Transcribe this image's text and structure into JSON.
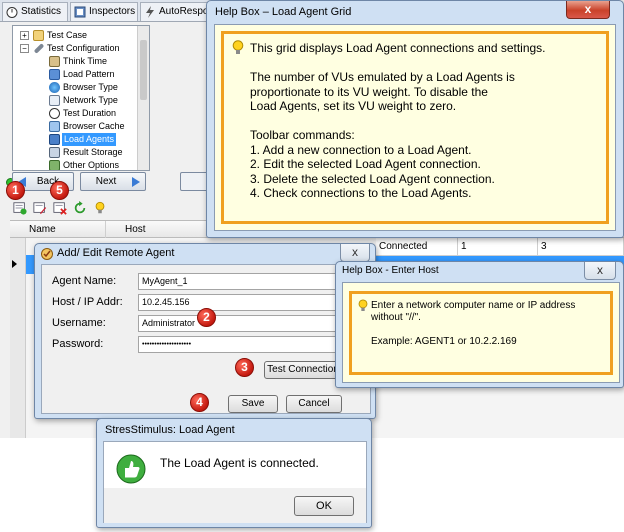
{
  "app": {
    "tabs": [
      {
        "label": "Statistics",
        "icon": "stopwatch-icon"
      },
      {
        "label": "Inspectors",
        "icon": "inspector-icon"
      },
      {
        "label": "AutoRespon",
        "icon": "lightning-icon"
      }
    ],
    "tree": {
      "items": [
        {
          "label": "Test Case",
          "icon": "folder-icon"
        },
        {
          "label": "Test Configuration",
          "icon": "wrench-icon"
        },
        {
          "label": "Think Time",
          "icon": "hourglass-icon"
        },
        {
          "label": "Load Pattern",
          "icon": "chart-icon"
        },
        {
          "label": "Browser Type",
          "icon": "globe-icon"
        },
        {
          "label": "Network Type",
          "icon": "network-icon"
        },
        {
          "label": "Test Duration",
          "icon": "clock-icon"
        },
        {
          "label": "Browser Cache",
          "icon": "cache-icon"
        },
        {
          "label": "Load Agents",
          "icon": "agents-icon"
        },
        {
          "label": "Result Storage",
          "icon": "storage-icon"
        },
        {
          "label": "Other Options",
          "icon": "options-icon"
        }
      ],
      "selected": "Load Agents"
    },
    "nav": {
      "back": "Back",
      "next": "Next"
    },
    "grid": {
      "headers": [
        "Name",
        "Host"
      ],
      "row": [
        "Connected",
        "1",
        "3"
      ]
    },
    "badges": [
      "1",
      "5",
      "2",
      "3",
      "4"
    ]
  },
  "help_grid": {
    "title": "Help Box – Load Agent Grid",
    "close": "x",
    "lines": [
      "This grid displays Load Agent connections and settings.",
      "",
      "The number of VUs emulated by a Load Agents is",
      "proportionate to its VU weight. To disable the",
      "Load Agents, set its VU weight to zero.",
      "",
      "Toolbar commands:",
      "1. Add a new connection to a Load Agent.",
      "2. Edit the selected Load Agent connection.",
      "3. Delete the selected Load Agent connection.",
      "4. Check connections to the Load Agents."
    ]
  },
  "remote_agent": {
    "title": "Add/ Edit Remote Agent",
    "close": "x",
    "fields": [
      {
        "label": "Agent Name:",
        "value": "MyAgent_1"
      },
      {
        "label": "Host / IP Addr:",
        "value": "10.2.45.156"
      },
      {
        "label": "Username:",
        "value": "Administrator"
      },
      {
        "label": "Password:",
        "value": "••••••••••••••••••••"
      }
    ],
    "test_connection": "Test Connection",
    "save": "Save",
    "cancel": "Cancel"
  },
  "host_help": {
    "title": "Help Box - Enter Host",
    "close": "x",
    "line1": "Enter a network computer name or IP address",
    "line2": "without \"//\".",
    "example": "Example: AGENT1 or 10.2.2.169"
  },
  "agent_msg": {
    "title": "StresStimulus: Load Agent",
    "message": "The Load Agent is connected.",
    "ok": "OK"
  }
}
